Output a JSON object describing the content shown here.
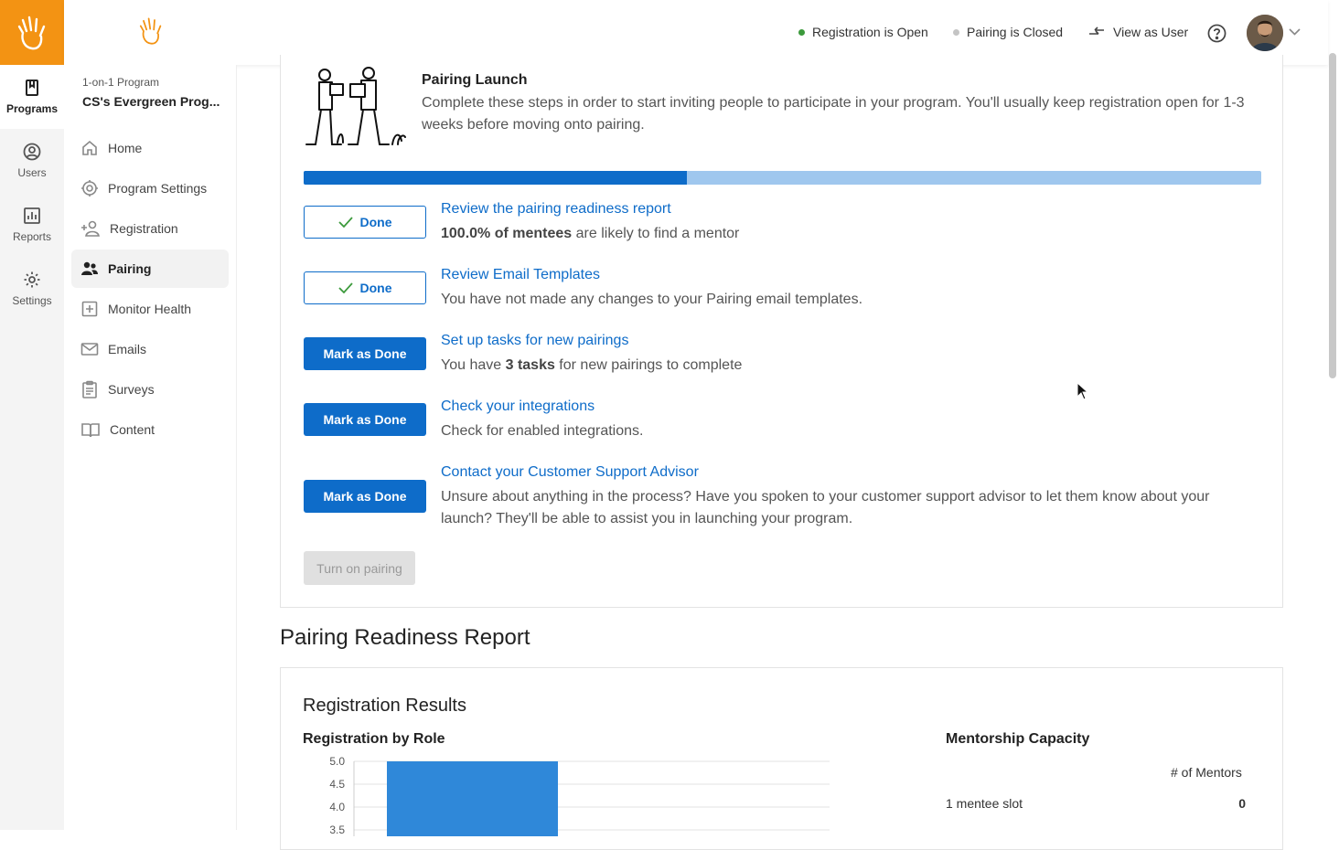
{
  "rail": {
    "items": [
      {
        "label": "Programs",
        "icon": "bookmark-icon",
        "active": true
      },
      {
        "label": "Users",
        "icon": "user-circle-icon",
        "active": false
      },
      {
        "label": "Reports",
        "icon": "bar-chart-icon",
        "active": false
      },
      {
        "label": "Settings",
        "icon": "gear-icon",
        "active": false
      }
    ]
  },
  "program": {
    "type": "1-on-1 Program",
    "name": "CS's Evergreen Prog..."
  },
  "nav": [
    {
      "label": "Home",
      "icon": "home-icon"
    },
    {
      "label": "Program Settings",
      "icon": "gear-icon"
    },
    {
      "label": "Registration",
      "icon": "add-user-icon"
    },
    {
      "label": "Pairing",
      "icon": "people-icon",
      "active": true
    },
    {
      "label": "Monitor Health",
      "icon": "plus-square-icon"
    },
    {
      "label": "Emails",
      "icon": "envelope-icon"
    },
    {
      "label": "Surveys",
      "icon": "clipboard-icon"
    },
    {
      "label": "Content",
      "icon": "book-icon"
    }
  ],
  "topbar": {
    "registration_status": "Registration is Open",
    "pairing_status": "Pairing is Closed",
    "view_as_user": "View as User",
    "status_colors": {
      "open": "#3c9a3c",
      "closed": "#c4c4c4"
    }
  },
  "launch": {
    "title": "Pairing Launch",
    "description": "Complete these steps in order to start inviting people to participate in your program. You'll usually keep registration open for 1-3 weeks before moving onto pairing.",
    "progress_fraction": 0.4,
    "steps": [
      {
        "state": "done",
        "button": "Done",
        "title": "Review the pairing readiness report",
        "desc_bold": "100.0% of mentees",
        "desc": " are likely to find a mentor"
      },
      {
        "state": "done",
        "button": "Done",
        "title": "Review Email Templates",
        "desc_bold": "",
        "desc": "You have not made any changes to your Pairing email templates."
      },
      {
        "state": "todo",
        "button": "Mark as Done",
        "title": "Set up tasks for new pairings",
        "desc_pre": "You have ",
        "desc_bold": "3 tasks",
        "desc": " for new pairings to complete"
      },
      {
        "state": "todo",
        "button": "Mark as Done",
        "title": "Check your integrations",
        "desc_bold": "",
        "desc": "Check for enabled integrations."
      },
      {
        "state": "todo",
        "button": "Mark as Done",
        "title": "Contact your Customer Support Advisor",
        "desc_bold": "",
        "desc": "Unsure about anything in the process? Have you spoken to your customer support advisor to let them know about your launch? They'll be able to assist you in launching your program."
      }
    ],
    "turn_on_label": "Turn on pairing"
  },
  "report": {
    "title": "Pairing Readiness Report",
    "card_title": "Registration Results",
    "chart_title": "Registration by Role",
    "capacity_title": "Mentorship Capacity",
    "capacity_header": "# of Mentors",
    "capacity_rows": [
      {
        "label": "1 mentee slot",
        "value": "0"
      }
    ]
  },
  "chart_data": {
    "type": "bar",
    "title": "Registration by Role",
    "yticks": [
      "5.0",
      "4.5",
      "4.0",
      "3.5"
    ],
    "ylim": [
      3.5,
      5.0
    ],
    "values": [
      5.0
    ],
    "color": "#2f88d9"
  }
}
